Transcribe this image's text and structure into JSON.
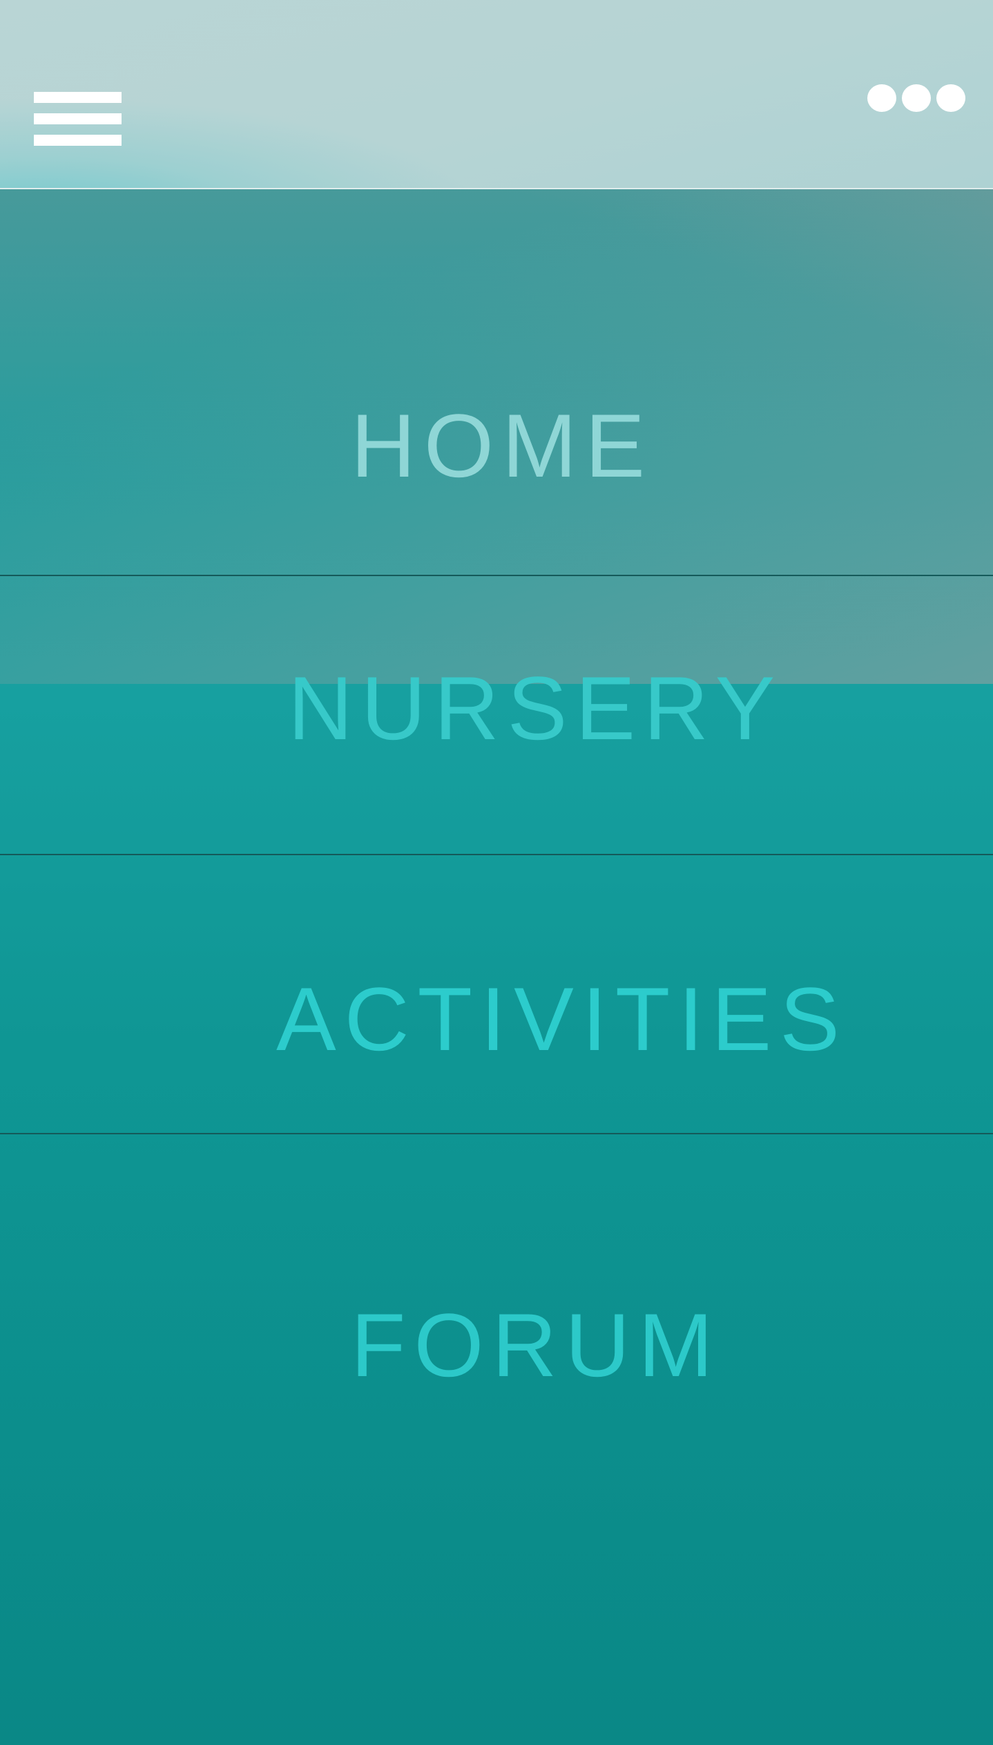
{
  "header": {
    "menu_icon": "hamburger-menu-icon",
    "more_icon": "more-options-icon"
  },
  "nav": {
    "items": [
      {
        "label": "HOME",
        "color": "#8fd6d6"
      },
      {
        "label": "NURSERY",
        "color": "#37c9c9"
      },
      {
        "label": "ACTIVITIES",
        "color": "#2ccccc"
      },
      {
        "label": "FORUM",
        "color": "#2cc9c9"
      }
    ]
  },
  "colors": {
    "header_background": "#b6d4d4",
    "page_background": "#0f9694",
    "divider": "#155a5a",
    "icon": "#ffffff"
  }
}
